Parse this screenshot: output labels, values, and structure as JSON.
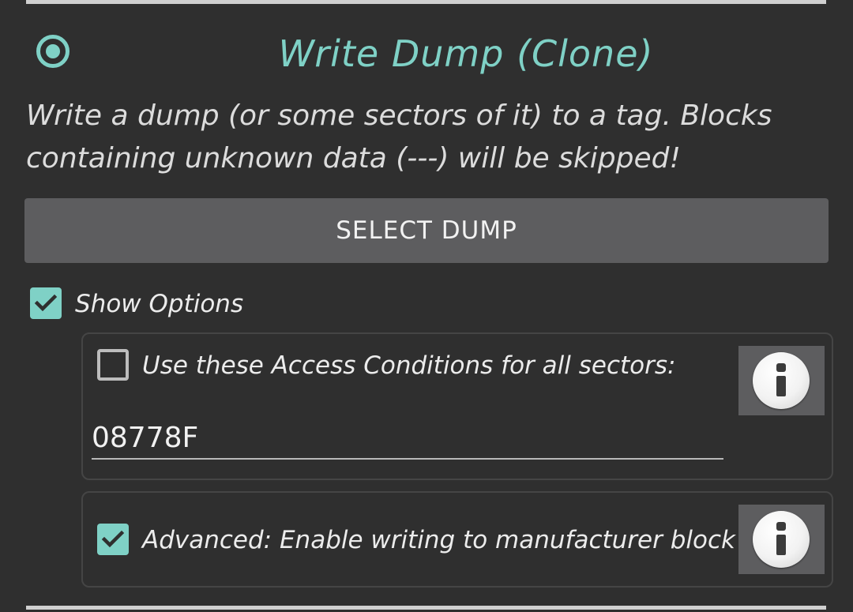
{
  "section": {
    "title": "Write Dump (Clone)",
    "description": "Write a dump (or some sectors of it) to a tag. Blocks containing unknown data (---) will be skipped!",
    "select_dump_label": "SELECT DUMP"
  },
  "options": {
    "show_options_label": "Show Options",
    "show_options_checked": true,
    "access_conditions": {
      "label": "Use these Access Conditions for all sectors:",
      "checked": false,
      "value": "08778F",
      "info_icon": "info-icon"
    },
    "manufacturer_block": {
      "label": "Advanced: Enable writing to manufacturer block",
      "checked": true,
      "info_icon": "info-icon"
    }
  },
  "colors": {
    "accent": "#7fd1c6",
    "background": "#2f2f2f",
    "button": "#5d5d5f",
    "text": "#dcdcdc"
  }
}
